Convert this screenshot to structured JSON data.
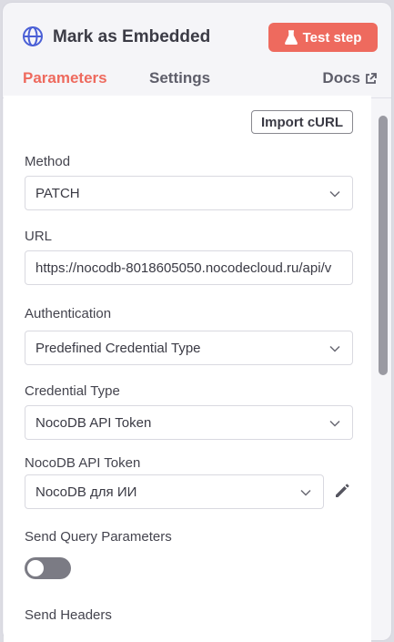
{
  "header": {
    "title": "Mark as Embedded",
    "test_button": "Test step",
    "icon": "globe-icon"
  },
  "tabs": [
    {
      "label": "Parameters",
      "active": true
    },
    {
      "label": "Settings",
      "active": false
    }
  ],
  "docs_label": "Docs",
  "import_curl": "Import cURL",
  "fields": {
    "method": {
      "label": "Method",
      "value": "PATCH"
    },
    "url": {
      "label": "URL",
      "value": "https://nocodb-8018605050.nocodecloud.ru/api/v"
    },
    "authentication": {
      "label": "Authentication",
      "value": "Predefined Credential Type"
    },
    "credential_type": {
      "label": "Credential Type",
      "value": "NocoDB API Token"
    },
    "api_token": {
      "label": "NocoDB API Token",
      "value": "NocoDB для ИИ"
    },
    "send_query": {
      "label": "Send Query Parameters",
      "enabled": false
    },
    "send_headers": {
      "label": "Send Headers"
    }
  },
  "colors": {
    "accent": "#ee6a5e",
    "icon_blue": "#4a5fd6"
  }
}
